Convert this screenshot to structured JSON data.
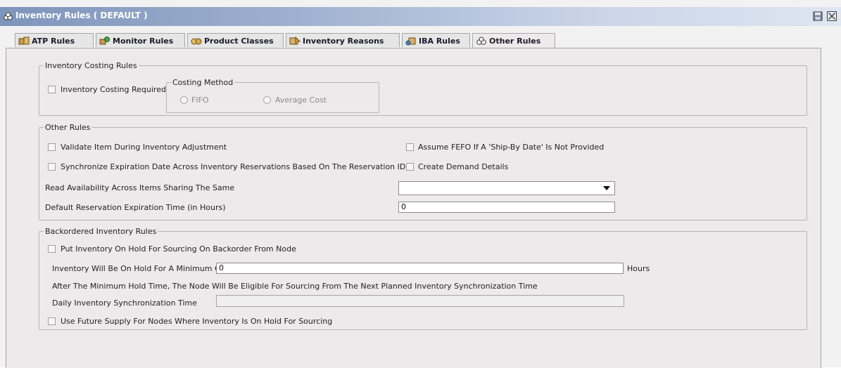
{
  "window": {
    "title": "Inventory Rules ( DEFAULT )",
    "save_icon": "save-icon",
    "close_icon": "close-icon"
  },
  "tabs": [
    {
      "label": "ATP Rules",
      "icon": "atp-rules-icon",
      "active": false
    },
    {
      "label": "Monitor Rules",
      "icon": "monitor-rules-icon",
      "active": false
    },
    {
      "label": "Product Classes",
      "icon": "product-classes-icon",
      "active": false
    },
    {
      "label": "Inventory Reasons",
      "icon": "inventory-reasons-icon",
      "active": false
    },
    {
      "label": "IBA Rules",
      "icon": "iba-rules-icon",
      "active": false
    },
    {
      "label": "Other Rules",
      "icon": "other-rules-icon",
      "active": true
    }
  ],
  "costing": {
    "legend": "Inventory Costing Rules",
    "costing_required_label": "Inventory Costing Required",
    "costing_required_checked": false,
    "method_legend": "Costing Method",
    "fifo_label": "FIFO",
    "average_cost_label": "Average Cost"
  },
  "other": {
    "legend": "Other Rules",
    "validate_item_label": "Validate Item During Inventory Adjustment",
    "sync_expiration_label": "Synchronize Expiration Date Across Inventory Reservations Based On The Reservation ID",
    "assume_fefo_label": "Assume FEFO If A 'Ship-By Date' Is Not Provided",
    "create_demand_label": "Create Demand Details",
    "read_availability_label": "Read Availability Across Items Sharing The Same",
    "read_availability_value": "",
    "default_expiration_label": "Default Reservation Expiration Time (in Hours)",
    "default_expiration_value": "0"
  },
  "backorder": {
    "legend": "Backordered Inventory Rules",
    "put_on_hold_label": "Put Inventory On Hold For Sourcing On Backorder From Node",
    "min_hold_label": "Inventory Will Be On Hold For A Minimum Of",
    "min_hold_value": "0",
    "hours_label": "Hours",
    "after_min_text": "After The Minimum Hold Time, The Node Will Be Eligible For Sourcing From The Next Planned Inventory Synchronization Time",
    "daily_sync_label": "Daily Inventory Synchronization Time",
    "daily_sync_value": "",
    "future_supply_label": "Use Future Supply For Nodes Where Inventory Is On Hold For Sourcing"
  },
  "colors": {
    "title_bar_start": "#7e95bb",
    "panel_bg": "#eceaea"
  }
}
